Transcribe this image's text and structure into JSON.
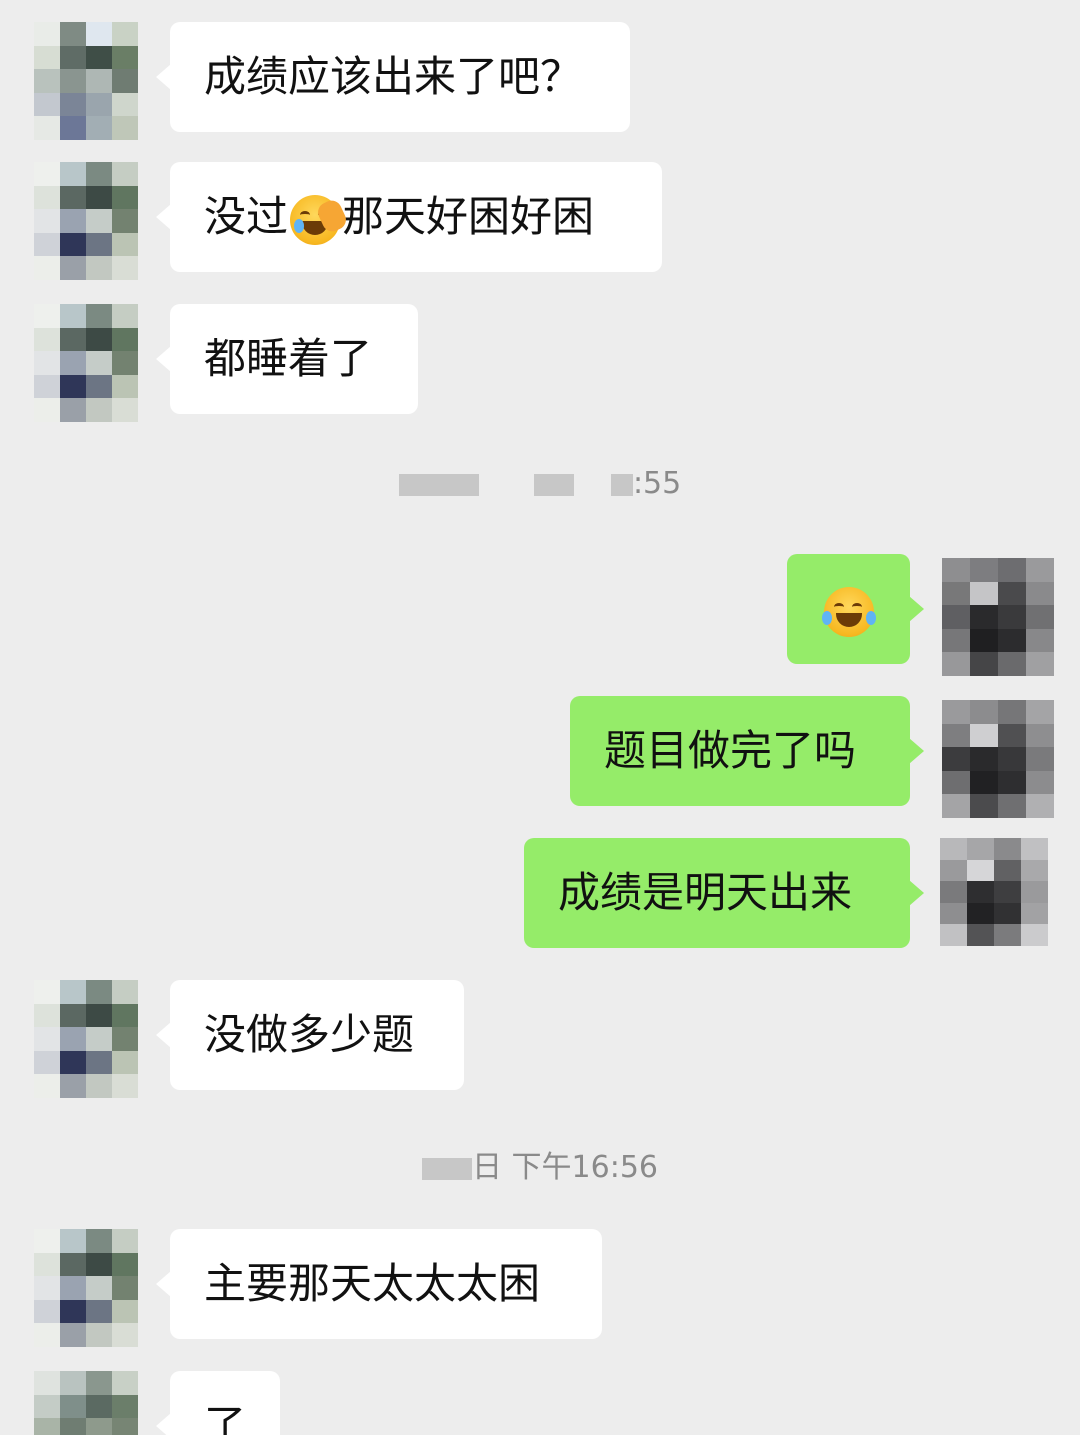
{
  "messages": [
    {
      "side": "in",
      "text": "成绩应该出来了吧？"
    },
    {
      "side": "in",
      "text_before": "没过",
      "emoji": "facepalm-crying-face",
      "text_after": "那天好困好困"
    },
    {
      "side": "in",
      "text": "都睡着了"
    },
    {
      "side": "time",
      "text": ":55"
    },
    {
      "side": "out",
      "emoji": "laughing-tears-face"
    },
    {
      "side": "out",
      "text": "题目做完了吗"
    },
    {
      "side": "out",
      "text": "成绩是明天出来"
    },
    {
      "side": "in",
      "text": "没做多少题"
    },
    {
      "side": "time",
      "text": "日 下午16:56"
    },
    {
      "side": "in",
      "text": "主要那天太太太困"
    },
    {
      "side": "in",
      "text": "了"
    }
  ],
  "colors": {
    "background": "#ededed",
    "incoming_bubble": "#ffffff",
    "outgoing_bubble": "#95ec69"
  }
}
